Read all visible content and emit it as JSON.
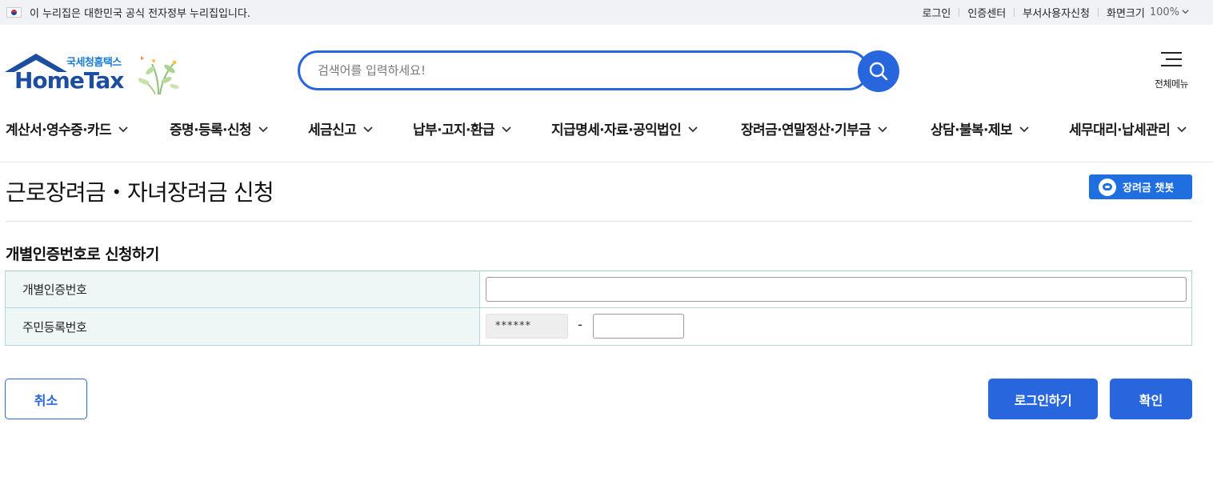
{
  "gov_bar": {
    "notice": "이 누리집은 대한민국 공식 전자정부 누리집입니다.",
    "links": [
      "로그인",
      "인증센터",
      "부서사용자신청",
      "화면크기"
    ],
    "zoom": "100%"
  },
  "header": {
    "logo_sub": "국세청홈택스",
    "logo_main": "HomeTax",
    "search_placeholder": "검색어를 입력하세요!",
    "all_menu_label": "전체메뉴"
  },
  "gnb": {
    "items": [
      "계산서·영수증·카드",
      "증명·등록·신청",
      "세금신고",
      "납부·고지·환급",
      "지급명세·자료·공익법인",
      "장려금·연말정산·기부금",
      "상담·불복·제보",
      "세무대리·납세관리"
    ]
  },
  "page": {
    "title": "근로장려금・자녀장려금 신청",
    "chatbot_label": "장려금 챗봇",
    "section_title": "개별인증번호로 신청하기"
  },
  "form": {
    "cert_label": "개별인증번호",
    "cert_value": "",
    "rrn_label": "주민등록번호",
    "rrn_front_masked": "******",
    "rrn_dash": "-",
    "rrn_back_value": ""
  },
  "buttons": {
    "cancel": "취소",
    "login": "로그인하기",
    "confirm": "확인"
  },
  "colors": {
    "primary": "#2766dd",
    "logo_blue": "#1d4d9f",
    "label_bg": "#eef6f6",
    "table_border": "#b5d7dc"
  }
}
